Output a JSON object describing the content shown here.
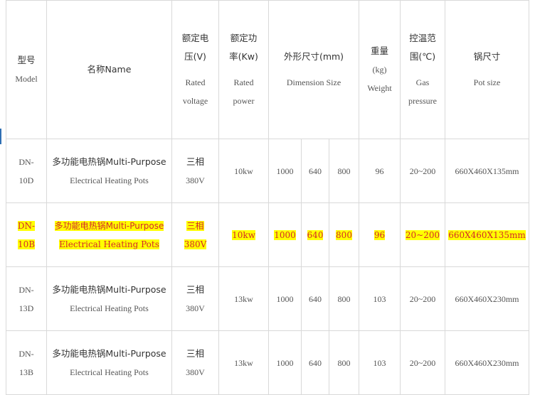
{
  "headers": {
    "model": {
      "zh": "型号",
      "en": "Model"
    },
    "name": {
      "text": "名称Name"
    },
    "voltage": {
      "zh1": "额定电",
      "zh2": "压(V)",
      "en1": "Rated",
      "en2": "voltage"
    },
    "power": {
      "zh1": "额定功",
      "zh2": "率(Kw)",
      "en1": "Rated",
      "en2": "power"
    },
    "dimension": {
      "zh": "外形尺寸(mm)",
      "en": "Dimension Size"
    },
    "weight": {
      "zh1": "重量",
      "zh2": "(kg)",
      "en": "Weight"
    },
    "temp": {
      "zh1": "控温范",
      "zh2": "围(℃)",
      "en1": "Gas",
      "en2": "pressure"
    },
    "pot": {
      "zh": "锅尺寸",
      "en": "Pot size"
    }
  },
  "rows": [
    {
      "model1": "DN-",
      "model2": "10D",
      "name1": "多功能电热锅Multi-Purpose",
      "name2": "Electrical Heating Pots",
      "volt1": "三相",
      "volt2": "380V",
      "power": "10kw",
      "d1": "1000",
      "d2": "640",
      "d3": "800",
      "weight": "96",
      "temp": "20~200",
      "pot": "660X460X135mm"
    },
    {
      "model1": "DN-",
      "model2": "10B",
      "name1": "多功能电热锅Multi-Purpose",
      "name2": "Electrical Heating Pots",
      "volt1": "三相",
      "volt2": "380V",
      "power": "10kw",
      "d1": "1000",
      "d2": "640",
      "d3": "800",
      "weight": "96",
      "temp": "20~200",
      "pot": "660X460X135mm"
    },
    {
      "model1": "DN-",
      "model2": "13D",
      "name1": "多功能电热锅Multi-Purpose",
      "name2": "Electrical Heating Pots",
      "volt1": "三相",
      "volt2": "380V",
      "power": "13kw",
      "d1": "1000",
      "d2": "640",
      "d3": "800",
      "weight": "103",
      "temp": "20~200",
      "pot": "660X460X230mm"
    },
    {
      "model1": "DN-",
      "model2": "13B",
      "name1": "多功能电热锅Multi-Purpose",
      "name2": "Electrical Heating Pots",
      "volt1": "三相",
      "volt2": "380V",
      "power": "13kw",
      "d1": "1000",
      "d2": "640",
      "d3": "800",
      "weight": "103",
      "temp": "20~200",
      "pot": "660X460X230mm"
    }
  ],
  "colors": {
    "highlight_bg": "#ffff00",
    "highlight_text": "#d42a2a",
    "border": "#d9d9d9",
    "accent": "#2f6fb3"
  }
}
